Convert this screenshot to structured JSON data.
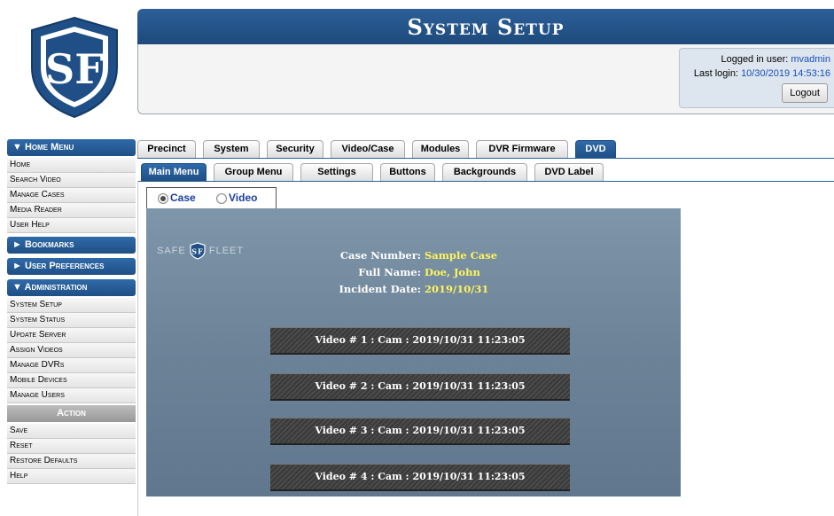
{
  "header": {
    "title": "System Setup",
    "login_label": "Logged in user:",
    "login_user": "mvadmin",
    "last_login_label": "Last login:",
    "last_login_value": "10/30/2019 14:53:16",
    "logout_label": "Logout"
  },
  "logo": {
    "text": "SF"
  },
  "sidebar": {
    "home_menu_title": "▼ Home Menu",
    "home_items": [
      "Home",
      "Search Video",
      "Manage Cases",
      "Media Reader",
      "User Help"
    ],
    "bookmarks_title": "► Bookmarks",
    "prefs_title": "► User Preferences",
    "admin_title": "▼ Administration",
    "admin_items": [
      "System Setup",
      "System Status",
      "Update Server",
      "Assign Videos",
      "Manage DVRs",
      "Mobile Devices",
      "Manage Users"
    ],
    "action_title": "Action",
    "action_items": [
      "Save",
      "Reset",
      "Restore Defaults",
      "Help"
    ]
  },
  "tabs": [
    "Precinct",
    "System",
    "Security",
    "Video/Case",
    "Modules",
    "DVR Firmware",
    "DVD"
  ],
  "subtabs": [
    "Main Menu",
    "Group Menu",
    "Settings",
    "Buttons",
    "Backgrounds",
    "DVD Label"
  ],
  "radio": {
    "case_label": "Case",
    "video_label": "Video",
    "selected": "Case"
  },
  "dvd": {
    "brand_left": "SAFE",
    "brand_right": "FLEET",
    "case_number_label": "Case Number:",
    "case_number": "Sample Case",
    "full_name_label": "Full Name:",
    "full_name": "Doe, John",
    "incident_date_label": "Incident Date:",
    "incident_date": "2019/10/31",
    "videos": [
      "Video # 1 : Cam : 2019/10/31 11:23:05",
      "Video # 2 : Cam : 2019/10/31 11:23:05",
      "Video # 3 : Cam : 2019/10/31 11:23:05",
      "Video # 4 : Cam : 2019/10/31 11:23:05"
    ]
  },
  "colors": {
    "primary_blue": "#2c5f98",
    "value_yellow": "#fff45a",
    "dvd_bg": "#6d8499"
  }
}
